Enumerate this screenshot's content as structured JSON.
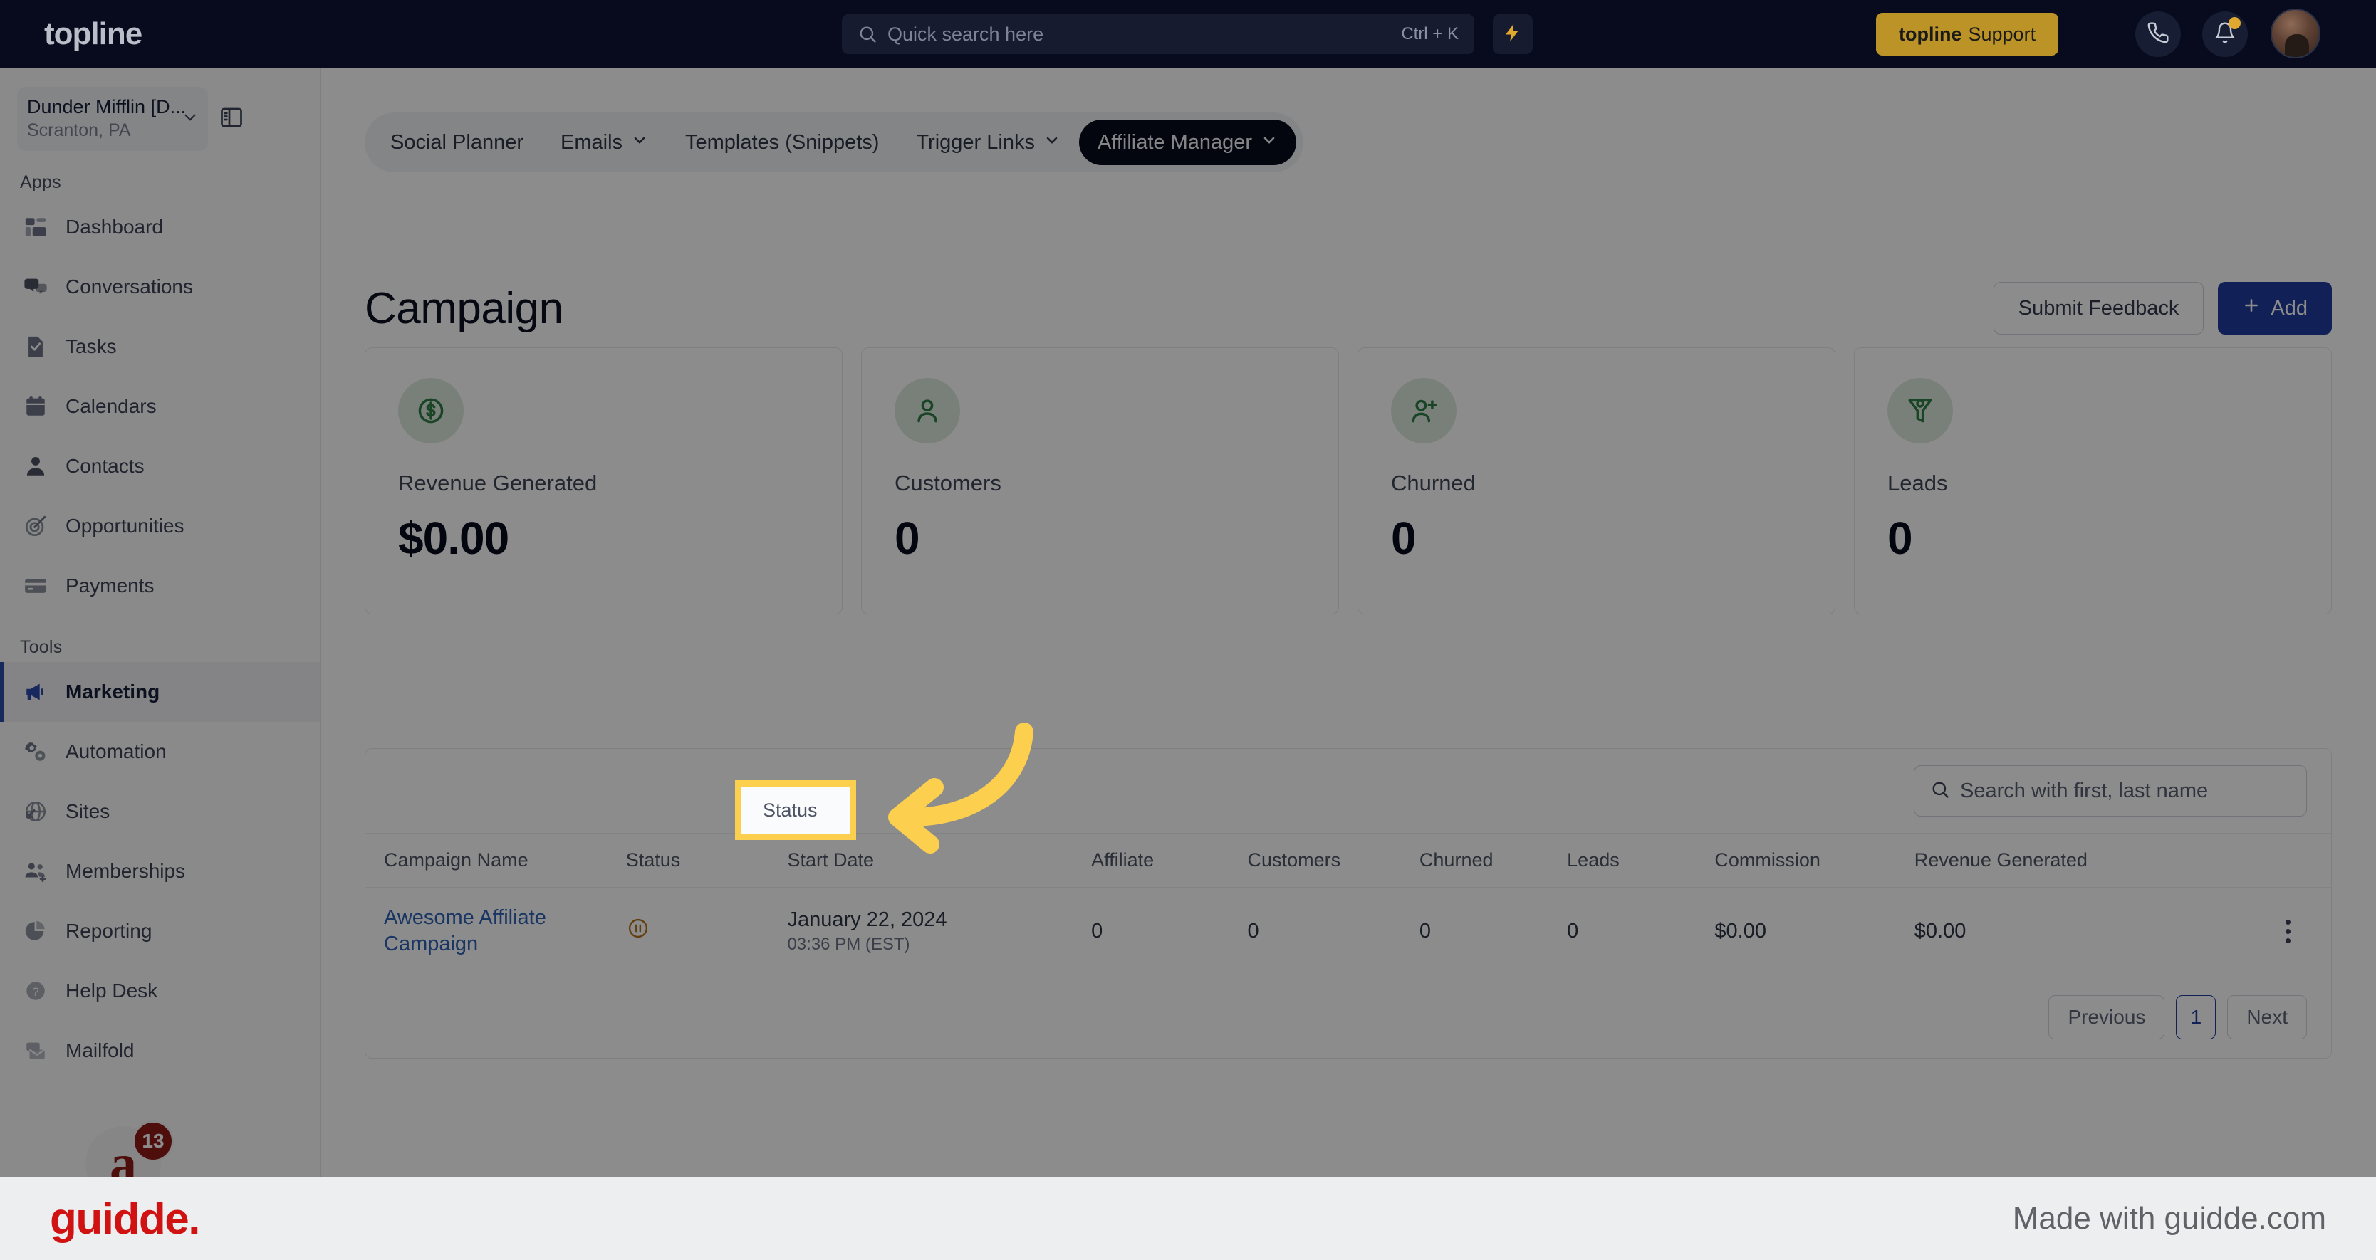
{
  "topbar": {
    "brand": "topline",
    "search": {
      "placeholder": "Quick search here",
      "shortcut": "Ctrl + K",
      "icon": "search-icon"
    },
    "bolt_icon": "lightning-bolt-icon",
    "support_button": {
      "brand": "topline",
      "label": "Support"
    },
    "phone_icon": "phone-icon",
    "bell_icon": "bell-icon",
    "avatar": "user-avatar"
  },
  "sidebar": {
    "location": {
      "name": "Dunder Mifflin [D...",
      "sub": "Scranton, PA",
      "chevron": "chevron-down-icon"
    },
    "panel_toggle_icon": "panel-collapse-icon",
    "groups": [
      {
        "label": "Apps",
        "items": [
          {
            "label": "Dashboard",
            "icon": "dashboard-icon"
          },
          {
            "label": "Conversations",
            "icon": "chat-bubbles-icon"
          },
          {
            "label": "Tasks",
            "icon": "task-document-icon"
          },
          {
            "label": "Calendars",
            "icon": "calendar-icon"
          },
          {
            "label": "Contacts",
            "icon": "person-icon"
          },
          {
            "label": "Opportunities",
            "icon": "target-icon"
          },
          {
            "label": "Payments",
            "icon": "credit-card-icon"
          }
        ]
      },
      {
        "label": "Tools",
        "items": [
          {
            "label": "Marketing",
            "icon": "megaphone-icon",
            "active": true
          },
          {
            "label": "Automation",
            "icon": "gears-icon"
          },
          {
            "label": "Sites",
            "icon": "globe-icon"
          },
          {
            "label": "Memberships",
            "icon": "people-add-icon"
          },
          {
            "label": "Reporting",
            "icon": "pie-chart-icon"
          },
          {
            "label": "Help Desk",
            "icon": "question-circle-icon"
          },
          {
            "label": "Mailfold",
            "icon": "mail-stack-icon"
          }
        ]
      }
    ],
    "mail_widget": {
      "letter": "a",
      "badge": "13"
    }
  },
  "subnav": {
    "items": [
      {
        "label": "Social Planner",
        "caret": false,
        "active": false
      },
      {
        "label": "Emails",
        "caret": true,
        "active": false
      },
      {
        "label": "Templates (Snippets)",
        "caret": false,
        "active": false
      },
      {
        "label": "Trigger Links",
        "caret": true,
        "active": false
      },
      {
        "label": "Affiliate Manager",
        "caret": true,
        "active": true
      }
    ]
  },
  "page": {
    "title": "Campaign",
    "submit_feedback_label": "Submit Feedback",
    "add_label": "Add",
    "add_icon": "plus-icon"
  },
  "stats": [
    {
      "label": "Revenue Generated",
      "value": "$0.00",
      "icon": "dollar-circle-icon"
    },
    {
      "label": "Customers",
      "value": "0",
      "icon": "person-icon"
    },
    {
      "label": "Churned",
      "value": "0",
      "icon": "person-add-icon"
    },
    {
      "label": "Leads",
      "value": "0",
      "icon": "funnel-icon"
    }
  ],
  "table": {
    "search": {
      "placeholder": "Search with first, last name",
      "icon": "search-icon"
    },
    "columns": [
      "Campaign Name",
      "Status",
      "Start Date",
      "Affiliate",
      "Customers",
      "Churned",
      "Leads",
      "Commission",
      "Revenue Generated"
    ],
    "rows": [
      {
        "name": "Awesome Affiliate Campaign",
        "status_icon": "pause-circle-icon",
        "date": "January 22, 2024",
        "time": "03:36 PM (EST)",
        "affiliate": "0",
        "customers": "0",
        "churned": "0",
        "leads": "0",
        "commission": "$0.00",
        "revenue": "$0.00",
        "menu_icon": "kebab-menu-icon"
      }
    ],
    "pagination": {
      "previous": "Previous",
      "page": "1",
      "next": "Next"
    }
  },
  "annotation": {
    "highlight_label": "Status",
    "highlight_color": "#fdcf4e",
    "arrow_icon": "curved-arrow-left-icon"
  },
  "footer": {
    "logo": "guidde.",
    "made_with": "Made with guidde.com"
  },
  "colors": {
    "topbar_bg": "#070b1d",
    "accent_blue": "#1f3d9e",
    "support_gold": "#bb9327",
    "stat_icon_green": "#2e7d46",
    "link_blue": "#2f62b5",
    "status_orange": "#b5721a",
    "guidde_red": "#d01212"
  }
}
